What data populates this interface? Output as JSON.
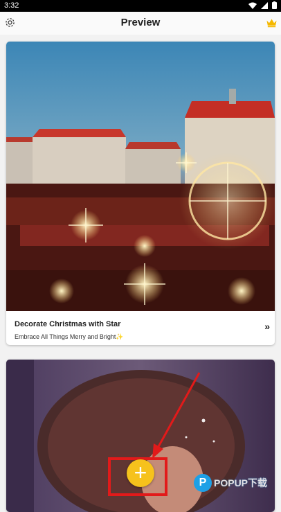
{
  "status_bar": {
    "time": "3:32"
  },
  "app_bar": {
    "title": "Preview"
  },
  "cards": [
    {
      "title": "Decorate Christmas with Star",
      "subtitle": "Embrace All Things Merry and Bright✨",
      "chevron": "»"
    },
    {
      "title": "",
      "subtitle": ""
    }
  ],
  "fab": {
    "label": "+"
  },
  "watermark": {
    "text": "POPUP下载"
  },
  "icons": {
    "settings": "gear-icon",
    "premium": "crown-icon",
    "add": "plus-icon"
  },
  "colors": {
    "accent": "#f6c21c",
    "highlight": "#e21a1a",
    "crown": "#f5b800"
  }
}
